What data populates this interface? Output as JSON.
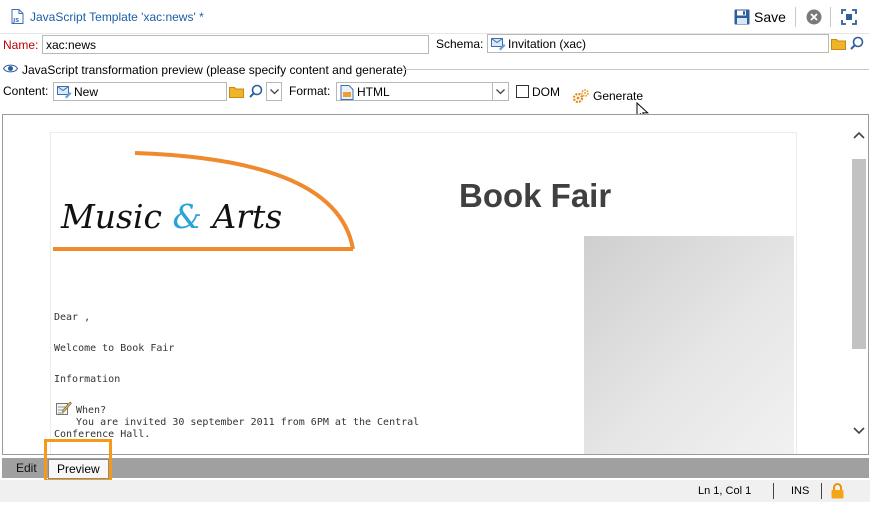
{
  "window": {
    "title": "JavaScript Template 'xac:news' *",
    "save_label": "Save"
  },
  "form": {
    "name_label": "Name:",
    "name_value": "xac:news",
    "schema_label": "Schema:",
    "schema_value": "Invitation (xac)",
    "section_title": "JavaScript transformation preview (please specify content and generate)",
    "content_label": "Content:",
    "content_value": "New",
    "format_label": "Format:",
    "format_value": "HTML",
    "dom_label": "DOM",
    "dom_checked": false,
    "generate_label": "Generate"
  },
  "preview": {
    "heading": "Book Fair",
    "logo": {
      "word1": "Music",
      "amp": "&",
      "word2": "Arts"
    },
    "greeting": "Dear ,",
    "welcome": "Welcome to Book Fair",
    "information": "Information",
    "when_label": "When?",
    "when_text_line1": "You are invited 30 september 2011 from 6PM at the Central",
    "when_text_line2": "Conference Hall."
  },
  "tabs": [
    {
      "label": "Edit",
      "active": false
    },
    {
      "label": "Preview",
      "active": true
    }
  ],
  "status": {
    "position": "Ln 1, Col 1",
    "mode": "INS"
  },
  "colors": {
    "accent_orange": "#f39a1b",
    "title_blue": "#1a5fa8",
    "name_label_red": "#c00000",
    "logo_arc": "#ef8a2e",
    "logo_amp": "#29a4d9"
  }
}
